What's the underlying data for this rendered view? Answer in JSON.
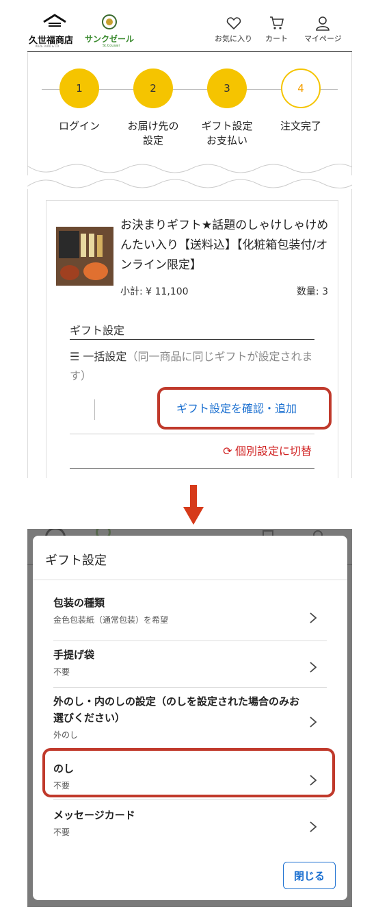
{
  "header": {
    "brand1": "久世福商店",
    "brand1_small": "KUZE FUKU & CO.",
    "brand2": "サンクゼール",
    "brand2_small": "St.Cousair",
    "nav": [
      {
        "label": "お気に入り",
        "icon": "heart-icon"
      },
      {
        "label": "カート",
        "icon": "cart-icon"
      },
      {
        "label": "マイページ",
        "icon": "user-icon"
      }
    ]
  },
  "steps": [
    {
      "num": "1",
      "label": "ログイン"
    },
    {
      "num": "2",
      "label": "お届け先の\n設定"
    },
    {
      "num": "3",
      "label": "ギフト設定\nお支払い"
    },
    {
      "num": "4",
      "label": "注文完了"
    }
  ],
  "product": {
    "name": "お決まりギフト★話題のしゃけしゃけめんたい入り【送料込】【化粧箱包装付/オンライン限定】",
    "subtotal": "小計: ¥ 11,100",
    "qty": "数量: 3"
  },
  "gift": {
    "title": "ギフト設定",
    "bulk_label": "☰ 一括設定",
    "bulk_note": "（同一商品に同じギフトが設定されます）",
    "confirm_label": "ギフト設定を確認・追加",
    "switch_label": "個別設定に切替"
  },
  "dialog": {
    "title": "ギフト設定",
    "options": [
      {
        "title": "包装の種類",
        "sub": "金色包装紙（通常包装）を希望"
      },
      {
        "title": "手提げ袋",
        "sub": "不要"
      },
      {
        "title": "外のし・内のしの設定（のしを設定された場合のみお選びください）",
        "sub": "外のし"
      },
      {
        "title": "のし",
        "sub": "不要"
      },
      {
        "title": "メッセージカード",
        "sub": "不要"
      }
    ],
    "close_label": "閉じる"
  },
  "colors": {
    "step_yellow": "#f5c400",
    "link_blue": "#1a6fd0",
    "switch_red": "#d02020",
    "highlight_red": "#c0392b"
  }
}
